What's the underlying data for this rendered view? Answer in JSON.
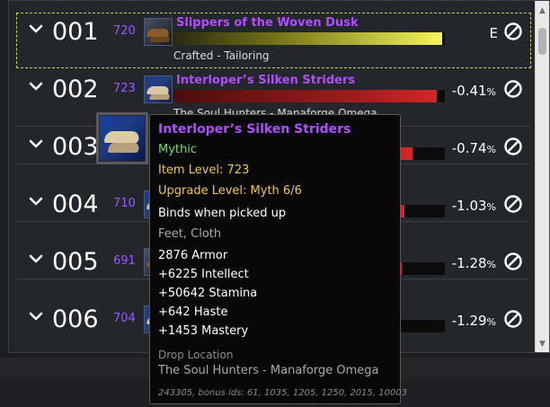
{
  "rows": [
    {
      "slot": "001",
      "ilvl": "720",
      "name": "Slippers of the Woven Dusk",
      "source": "Crafted - Tailoring",
      "delta": "E",
      "delta_pct": "",
      "bar_fraction": 0.99,
      "bar_color": "yellow",
      "selected": true
    },
    {
      "slot": "002",
      "ilvl": "723",
      "name": "Interloper’s Silken Striders",
      "source": "The Soul Hunters - Manaforge Omega",
      "delta": "-0.41",
      "delta_pct": "%",
      "bar_fraction": 0.97,
      "bar_color": "red",
      "selected": false
    },
    {
      "slot": "003",
      "ilvl": "",
      "name": "",
      "source": "",
      "delta": "-0.74",
      "delta_pct": "%",
      "bar_fraction": 0.88,
      "bar_color": "red",
      "selected": false
    },
    {
      "slot": "004",
      "ilvl": "710",
      "name": "",
      "source": "",
      "delta": "-1.03",
      "delta_pct": "%",
      "bar_fraction": 0.85,
      "bar_color": "red",
      "selected": false
    },
    {
      "slot": "005",
      "ilvl": "691",
      "name": "",
      "source": "",
      "delta": "-1.28",
      "delta_pct": "%",
      "bar_fraction": 0.84,
      "bar_color": "red",
      "selected": false
    },
    {
      "slot": "006",
      "ilvl": "704",
      "name": "",
      "source": "",
      "delta": "-1.29",
      "delta_pct": "%",
      "bar_fraction": 0.83,
      "bar_color": "red",
      "selected": false
    }
  ],
  "tooltip": {
    "name": "Interloper’s Silken Striders",
    "quality": "Mythic",
    "item_level": "Item Level: 723",
    "upgrade_level": "Upgrade Level: Myth 6/6",
    "binding": "Binds when picked up",
    "slot_type": "Feet, Cloth",
    "stats": [
      "2876 Armor",
      "+6225 Intellect",
      "+50642 Stamina",
      "+642 Haste",
      "+1453 Mastery"
    ],
    "drop_location_label": "Drop Location",
    "drop_location": "The Soul Hunters - Manaforge Omega",
    "item_ids": "243305, bonus ids: 61, 1035, 1205, 1250, 2015, 10003"
  },
  "colors": {
    "epic": "#b14dff",
    "mythic_green": "#6de15d",
    "gold": "#f2c64a",
    "selection_outline": "#b9d64a"
  },
  "icons": {
    "expand": "chevron-down-icon",
    "block": "block-icon",
    "scroll_up": "scroll-up-icon",
    "scroll_down": "scroll-down-icon"
  }
}
